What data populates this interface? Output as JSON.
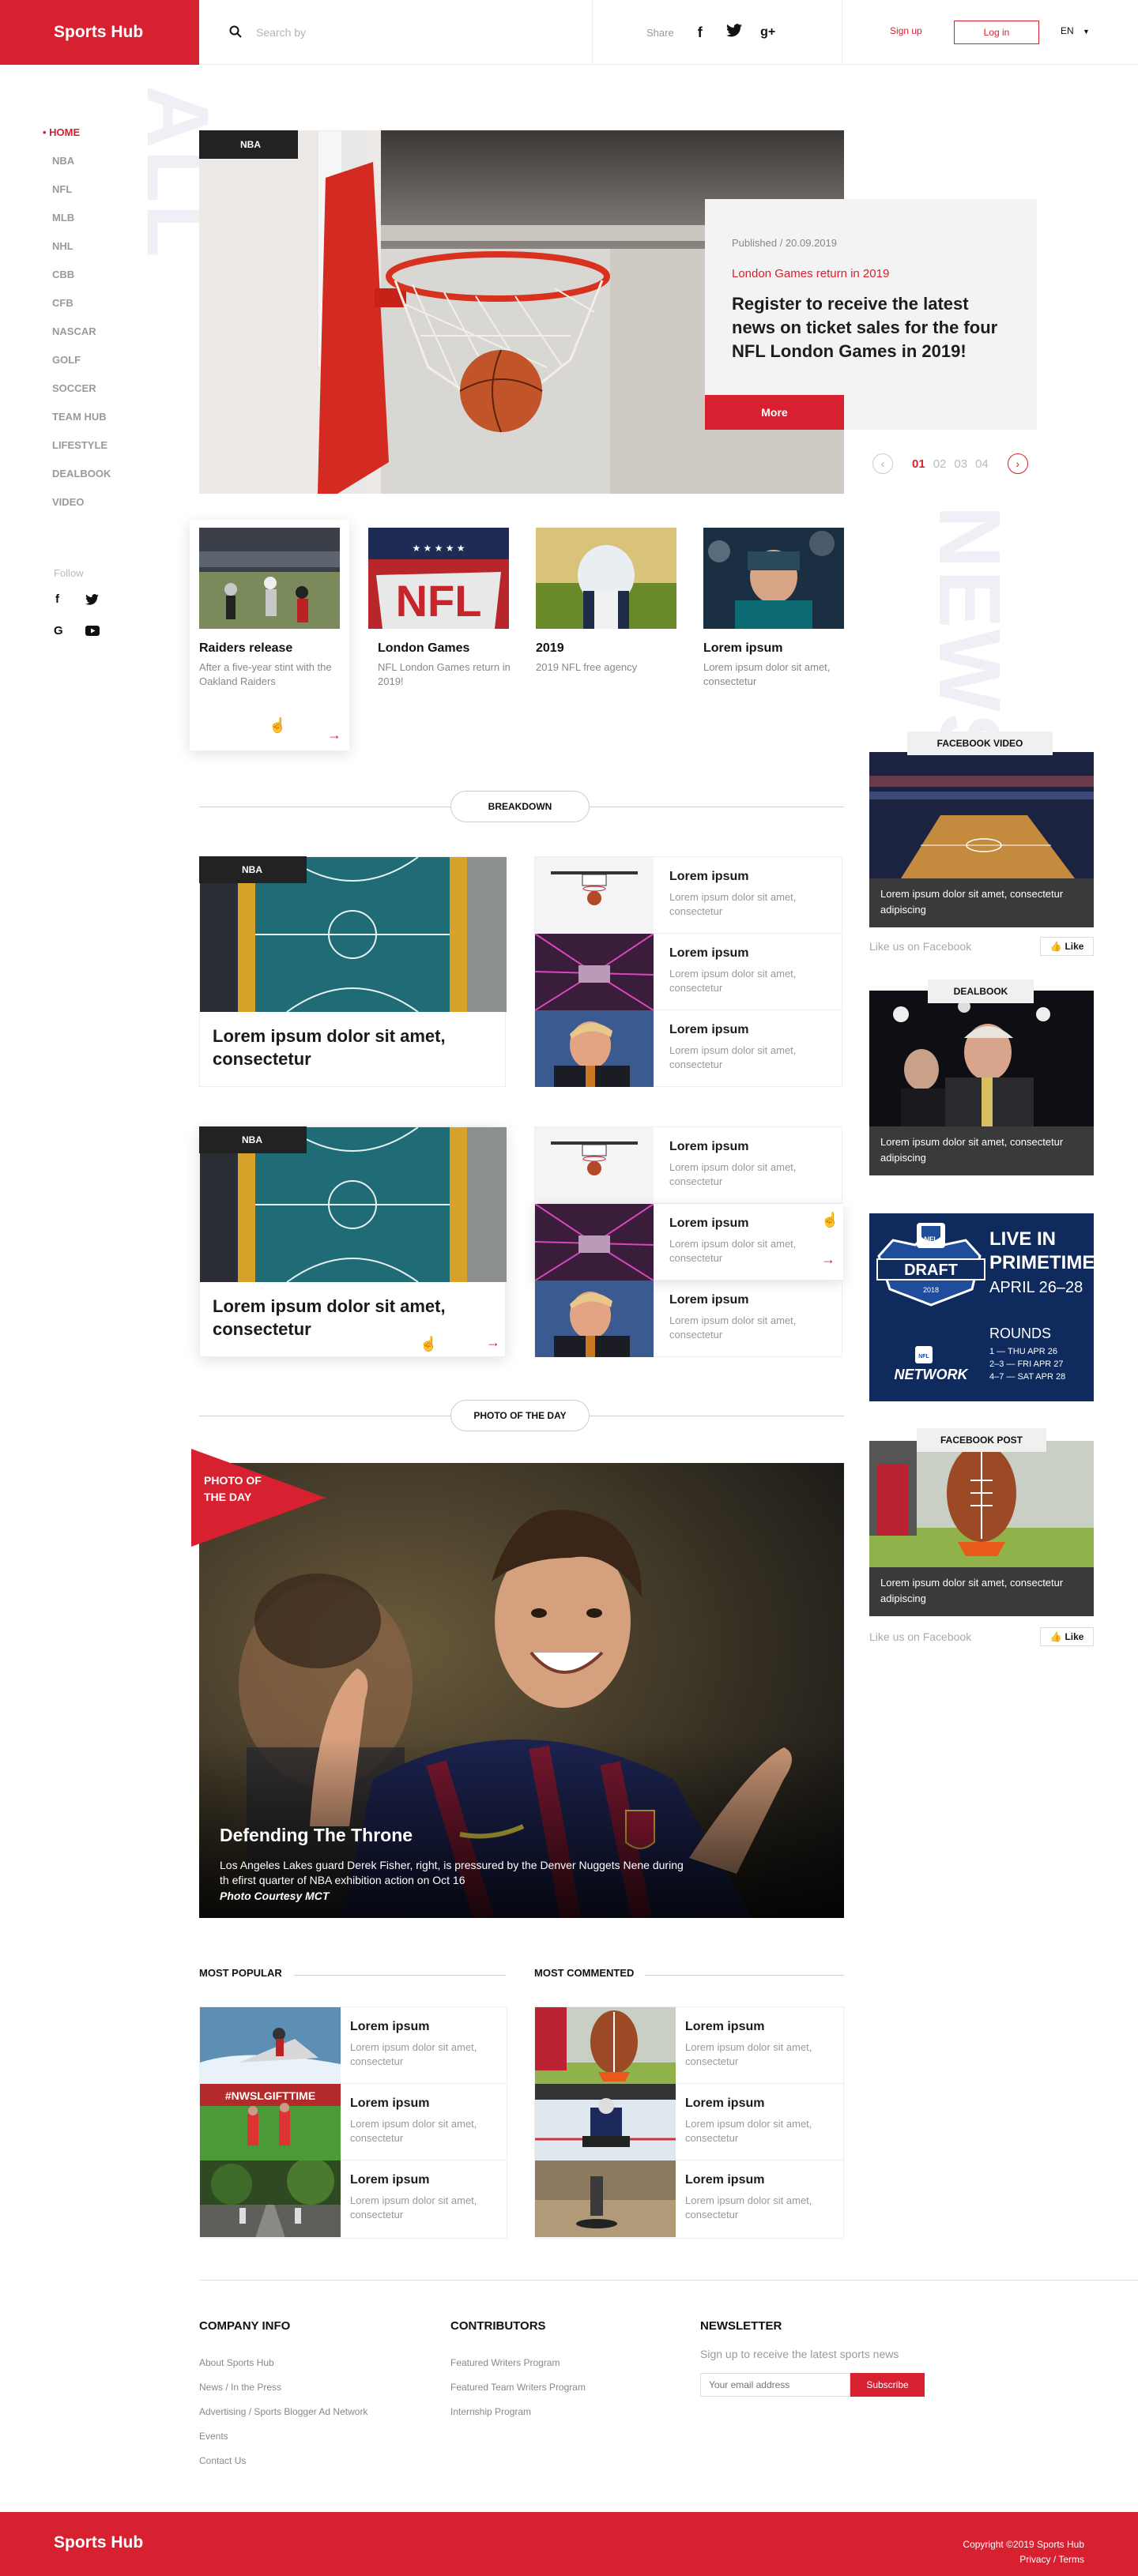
{
  "header": {
    "logo": "Sports Hub",
    "search_placeholder": "Search by",
    "share_label": "Share",
    "share_icons": [
      "facebook-icon",
      "twitter-icon",
      "google-plus-icon"
    ],
    "signup": "Sign up",
    "login": "Log in",
    "lang": "EN"
  },
  "sidebar": {
    "items": [
      "HOME",
      "NBA",
      "NFL",
      "MLB",
      "NHL",
      "CBB",
      "CFB",
      "NASCAR",
      "GOLF",
      "SOCCER",
      "TEAM HUB",
      "LIFESTYLE",
      "DEALBOOK",
      "VIDEO"
    ],
    "active": "HOME",
    "follow": "Follow",
    "big_word": "ALL"
  },
  "hero": {
    "tag": "NBA",
    "published": "Published / 20.09.2019",
    "subtitle": "London Games return in 2019",
    "title": "Register to receive the latest news on ticket sales for the four NFL London Games in 2019!",
    "more": "More",
    "pages": [
      "01",
      "02",
      "03",
      "04"
    ],
    "current_page": "01",
    "side_word": "NEWS"
  },
  "cards": [
    {
      "title": "Raiders release",
      "desc": "After a five-year stint with the Oakland Raiders"
    },
    {
      "title": "London Games",
      "desc": "NFL London Games return in 2019!"
    },
    {
      "title": "2019",
      "desc": "2019 NFL free agency"
    },
    {
      "title": "Lorem ipsum",
      "desc": "Lorem ipsum dolor sit amet, consectetur"
    }
  ],
  "breakdown": {
    "label": "BREAKDOWN",
    "blocks": [
      {
        "tag": "NBA",
        "title": "Lorem ipsum dolor sit amet, consectetur",
        "list": [
          {
            "title": "Lorem ipsum",
            "desc": "Lorem ipsum dolor sit amet, consectetur"
          },
          {
            "title": "Lorem ipsum",
            "desc": "Lorem ipsum dolor sit amet, consectetur"
          },
          {
            "title": "Lorem ipsum",
            "desc": "Lorem ipsum dolor sit amet, consectetur"
          }
        ]
      },
      {
        "tag": "NBA",
        "title": "Lorem ipsum dolor sit amet, consectetur",
        "list": [
          {
            "title": "Lorem ipsum",
            "desc": "Lorem ipsum dolor sit amet, consectetur"
          },
          {
            "title": "Lorem ipsum",
            "desc": "Lorem ipsum dolor sit amet, consectetur"
          },
          {
            "title": "Lorem ipsum",
            "desc": "Lorem ipsum dolor sit amet, consectetur"
          }
        ]
      }
    ]
  },
  "right": {
    "fb_video": {
      "label": "FACEBOOK VIDEO",
      "caption": "Lorem ipsum dolor sit amet, consectetur adipiscing"
    },
    "like_text": "Like us on Facebook",
    "like_btn": "Like",
    "dealbook": {
      "label": "DEALBOOK",
      "caption": "Lorem ipsum dolor sit amet, consectetur adipiscing"
    },
    "ad": {
      "draft": "DRAFT",
      "year": "2018",
      "line1": "LIVE IN",
      "line2": "PRIMETIME",
      "dates": "APRIL 26–28",
      "rounds": "ROUNDS",
      "r1": "1 — THU APR 26",
      "r2": "2–3 — FRI APR 27",
      "r3": "4–7 — SAT APR 28",
      "network": "NETWORK"
    },
    "fb_post": {
      "label": "FACEBOOK POST",
      "caption": "Lorem ipsum dolor sit amet, consectetur adipiscing"
    }
  },
  "photo_of_day": {
    "label": "PHOTO OF THE DAY",
    "flag": "PHOTO OF THE DAY",
    "title": "Defending The Throne",
    "desc": "Los Angeles Lakes guard Derek Fisher, right, is pressured by the Denver Nuggets Nene during th efirst quarter of NBA exhibition action on Oct 16",
    "credit": "Photo Courtesy MCT"
  },
  "most_popular": {
    "label": "MOST POPULAR",
    "items": [
      {
        "title": "Lorem ipsum",
        "desc": "Lorem ipsum dolor sit amet, consectetur"
      },
      {
        "title": "Lorem ipsum",
        "desc": "Lorem ipsum dolor sit amet, consectetur"
      },
      {
        "title": "Lorem ipsum",
        "desc": "Lorem ipsum dolor sit amet, consectetur"
      }
    ]
  },
  "most_commented": {
    "label": "MOST COMMENTED",
    "items": [
      {
        "title": "Lorem ipsum",
        "desc": "Lorem ipsum dolor sit amet, consectetur"
      },
      {
        "title": "Lorem ipsum",
        "desc": "Lorem ipsum dolor sit amet, consectetur"
      },
      {
        "title": "Lorem ipsum",
        "desc": "Lorem ipsum dolor sit amet, consectetur"
      }
    ]
  },
  "footer": {
    "company": {
      "title": "COMPANY INFO",
      "links": [
        "About Sports Hub",
        "News / In the Press",
        "Advertising / Sports Blogger Ad Network",
        "Events",
        "Contact Us"
      ]
    },
    "contributors": {
      "title": "CONTRIBUTORS",
      "links": [
        "Featured Writers Program",
        "Featured Team Writers Program",
        "Internship Program"
      ]
    },
    "newsletter": {
      "title": "NEWSLETTER",
      "text": "Sign up to receive the latest sports news",
      "placeholder": "Your email address",
      "button": "Subscribe"
    },
    "logo": "Sports Hub",
    "copyright": "Copyright ©2019 Sports Hub",
    "legal": "Privacy / Terms"
  },
  "colors": {
    "accent": "#d72130",
    "dark": "#222222"
  }
}
